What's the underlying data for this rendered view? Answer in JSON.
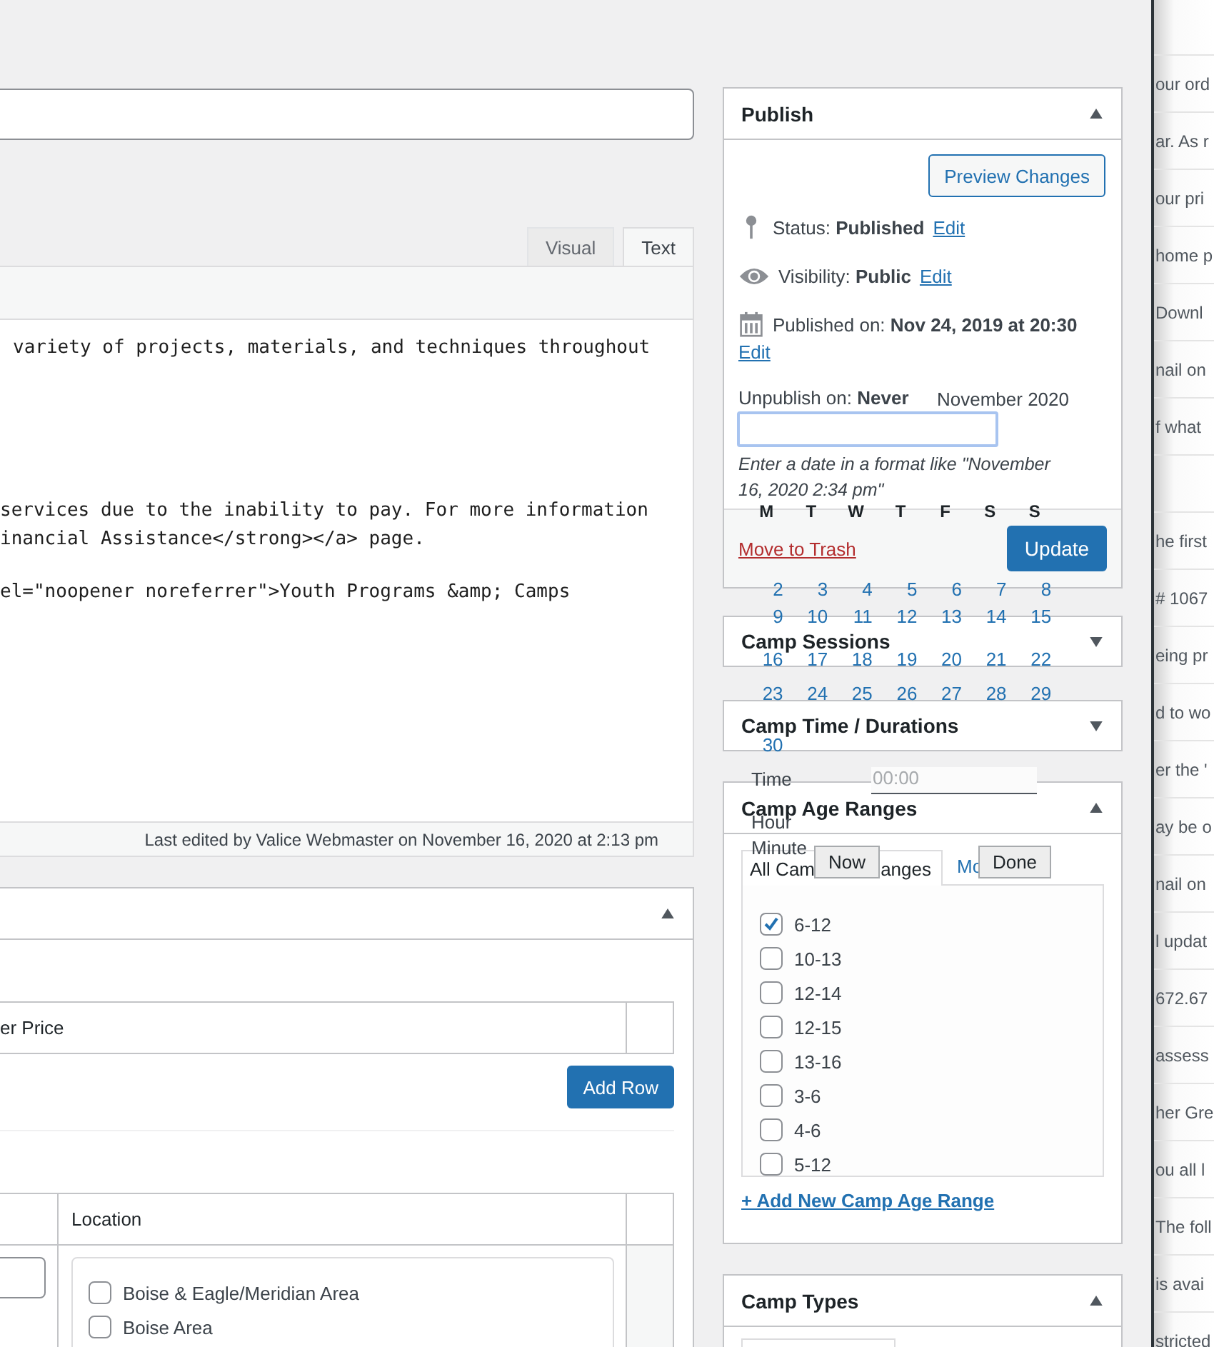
{
  "editor": {
    "tabs": [
      {
        "label": "Visual",
        "selected": false
      },
      {
        "label": "Text",
        "selected": true
      }
    ],
    "paragraphs": [
      [
        "variety of projects, materials, and techniques throughout"
      ],
      [
        "services due to the inability to pay. For more information",
        "inancial Assistance</strong></a> page."
      ],
      [
        "el=\"noopener noreferrer\">Youth Programs &amp; Camps"
      ]
    ],
    "status": "Last edited by Valice Webmaster on November 16, 2020 at 2:13 pm"
  },
  "pricing_panel": {
    "expanded": true,
    "price_header": "er Price",
    "add_row_button": "Add Row",
    "location_header": "Location",
    "locations": [
      {
        "label": "Boise & Eagle/Meridian Area",
        "checked": false
      },
      {
        "label": "Boise Area",
        "checked": false
      }
    ]
  },
  "publish": {
    "title": "Publish",
    "expanded": true,
    "preview_button": "Preview Changes",
    "status": "Status: **Published**",
    "status_edit": "Edit",
    "visibility": "Visibility: **Public**",
    "visibility_edit": "Edit",
    "published_on": "Published on: **Nov 24, 2019 at 20:30**",
    "published_edit": "Edit",
    "unpublish": "Unpublish on: **Never**",
    "hint": "Enter a date in a format like \"November 16, 2020 2:34 pm\"",
    "trash_link": "Move to Trash",
    "update_button": "Update"
  },
  "collapsed_boxes": [
    {
      "title": "Camp Sessions",
      "expanded": false
    },
    {
      "title": "Camp Time / Durations",
      "expanded": false
    }
  ],
  "age_ranges": {
    "title": "Camp Age Ranges",
    "expanded": true,
    "tabs": [
      {
        "label_start": "All Cam",
        "label_end": "anges",
        "selected": true
      },
      {
        "label_start": "Mo",
        "selected": false
      }
    ],
    "items": [
      {
        "label": "6-12",
        "checked": true
      },
      {
        "label": "10-13",
        "checked": false
      },
      {
        "label": "12-14",
        "checked": false
      },
      {
        "label": "12-15",
        "checked": false
      },
      {
        "label": "13-16",
        "checked": false
      },
      {
        "label": "3-6",
        "checked": false
      },
      {
        "label": "4-6",
        "checked": false
      },
      {
        "label": "5-12",
        "checked": false
      }
    ],
    "add_link": "+ Add New Camp Age Range"
  },
  "camp_types": {
    "title": "Camp Types",
    "expanded": true
  },
  "datepicker": {
    "month": "November 2020",
    "weekdays": [
      "M",
      "T",
      "W",
      "T",
      "F",
      "S",
      "S"
    ],
    "weeks": [
      [
        "2",
        "3",
        "4",
        "5",
        "6",
        "7",
        "8"
      ],
      [
        "9",
        "10",
        "11",
        "12",
        "13",
        "14",
        "15"
      ],
      [
        "16",
        "17",
        "18",
        "19",
        "20",
        "21",
        "22"
      ],
      [
        "23",
        "24",
        "25",
        "26",
        "27",
        "28",
        "29"
      ],
      [
        "30"
      ]
    ],
    "time_label": "Time",
    "time_value": "00:00",
    "hour_label": "Hour",
    "minute_label": "Minute",
    "now_button": "Now",
    "done_button": "Done"
  },
  "side_panel": {
    "rows": [
      "our ord",
      "ar. As r",
      "our pri",
      "home p",
      "Downl",
      "nail on",
      "f what",
      null,
      "he first",
      "# 1067",
      "eing pr",
      "d to wo",
      "er the '",
      "ay be o",
      "nail on",
      "l updat",
      "672.67",
      "assess",
      "her Gre",
      "ou all l",
      "The foll",
      "is avai",
      "stricted"
    ]
  }
}
